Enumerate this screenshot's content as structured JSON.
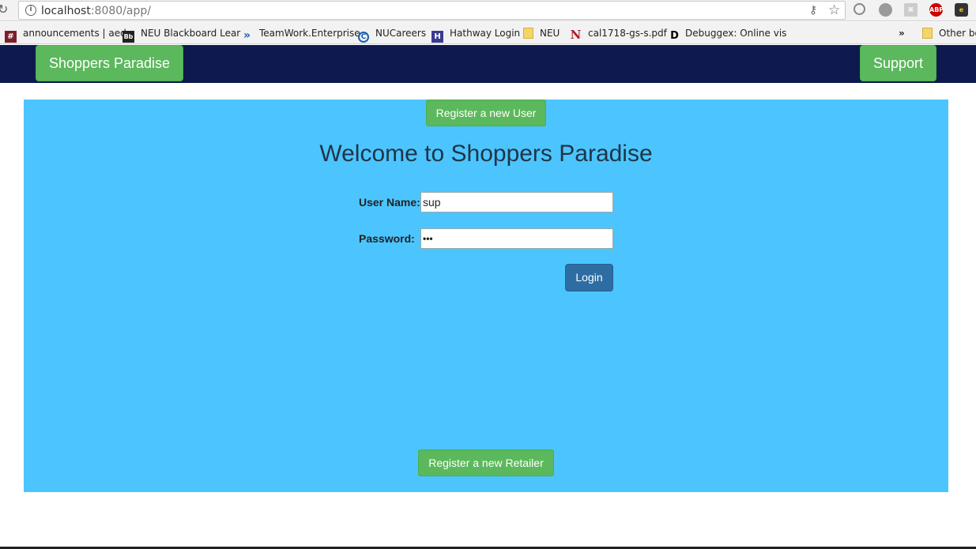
{
  "browser": {
    "url_host": "localhost",
    "url_rest": ":8080/app/",
    "bookmarks": [
      {
        "icon": "#",
        "label": "announcements | aed"
      },
      {
        "icon": "Bb",
        "label": "NEU Blackboard Lear"
      },
      {
        "icon": "»",
        "label": "TeamWork.Enterprise"
      },
      {
        "icon": "C",
        "label": "NUCareers"
      },
      {
        "icon": "H",
        "label": "Hathway Login"
      },
      {
        "icon": "",
        "label": "NEU"
      },
      {
        "icon": "N",
        "label": "cal1718-gs-s.pdf"
      },
      {
        "icon": "D",
        "label": "Debuggex: Online vis"
      }
    ],
    "overflow": "»",
    "other_bookmarks": "Other bo"
  },
  "navbar": {
    "brand_label": "Shoppers Paradise",
    "support_label": "Support"
  },
  "main": {
    "register_user_label": "Register a new User",
    "welcome_title": "Welcome to Shoppers Paradise",
    "username_label": "User Name:",
    "username_value": "sup",
    "password_label": "Password:",
    "password_value": "•••",
    "login_label": "Login",
    "register_retailer_label": "Register a new Retailer"
  },
  "colors": {
    "navbar_bg": "#0e1a4f",
    "panel_bg": "#4cc5fe",
    "button_green": "#5cb85c",
    "login_blue": "#2e6da4"
  }
}
